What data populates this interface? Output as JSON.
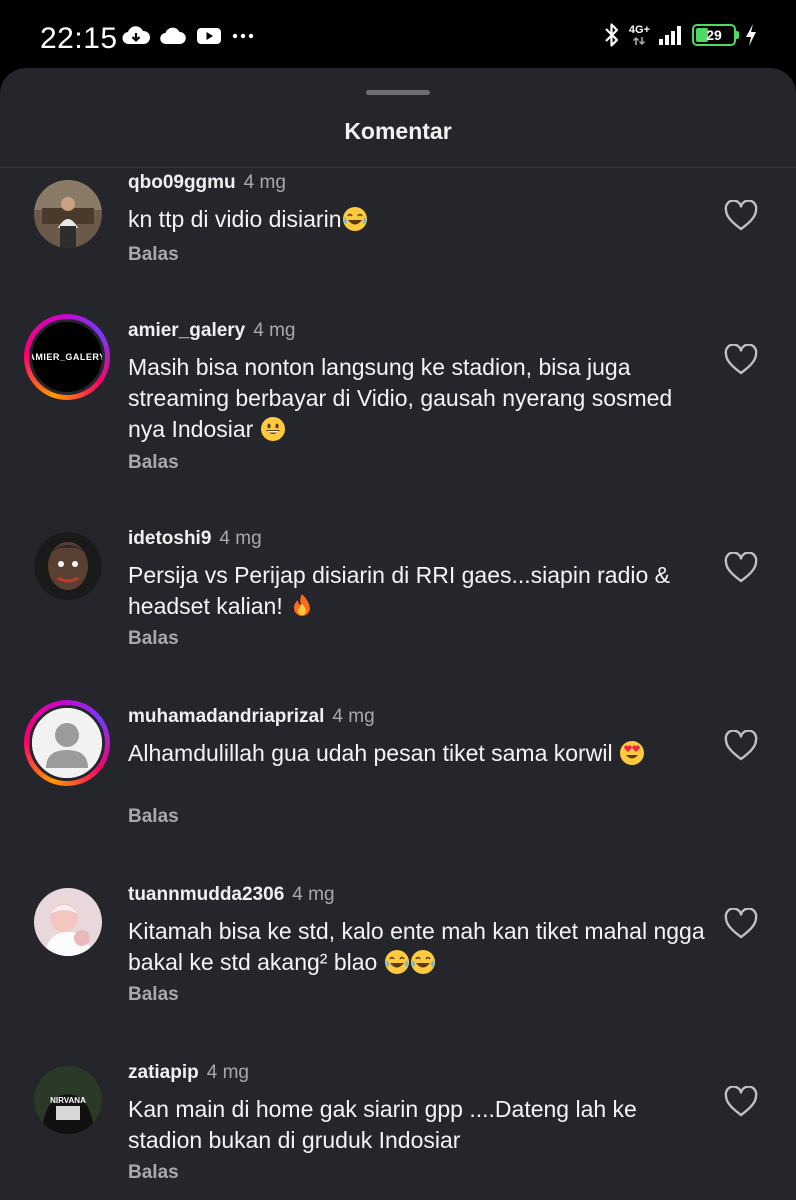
{
  "status_bar": {
    "time": "22:15",
    "network": "4G+",
    "battery_level": "29"
  },
  "sheet": {
    "title": "Komentar"
  },
  "comments": [
    {
      "username": "qbo09ggmu",
      "age": "4 mg",
      "text": "kn ttp di vidio disiarin",
      "emoji": "laugh-cry",
      "emoji_count": 1,
      "reply_label": "Balas"
    },
    {
      "username": "amier_galery",
      "age": "4 mg",
      "text": "Masih bisa nonton langsung ke stadion, bisa juga streaming berbayar di Vidio, gausah nyerang sosmed nya Indosiar ",
      "emoji": "grin",
      "emoji_count": 1,
      "reply_label": "Balas",
      "avatar_logo_text": "AMIER_GALERY"
    },
    {
      "username": "idetoshi9",
      "age": "4 mg",
      "text": "Persija vs Perijap disiarin di RRI gaes...siapin radio & headset kalian! ",
      "emoji": "fire",
      "emoji_count": 1,
      "reply_label": "Balas"
    },
    {
      "username": "muhamadandriaprizal",
      "age": "4 mg",
      "text": "Alhamdulillah gua udah pesan tiket sama korwil ",
      "emoji": "heart-eyes",
      "emoji_count": 1,
      "reply_label": "Balas"
    },
    {
      "username": "tuannmudda2306",
      "age": "4 mg",
      "text": "Kitamah bisa ke std, kalo ente mah kan tiket mahal ngga bakal ke std akang² blao ",
      "emoji": "laugh-cry",
      "emoji_count": 2,
      "reply_label": "Balas"
    },
    {
      "username": "zatiapip",
      "age": "4 mg",
      "text": "Kan main di home gak siarin gpp ....Dateng lah ke stadion bukan di gruduk Indosiar",
      "emoji": "",
      "emoji_count": 0,
      "reply_label": "Balas",
      "avatar_logo_text": "NIRVANA"
    }
  ]
}
